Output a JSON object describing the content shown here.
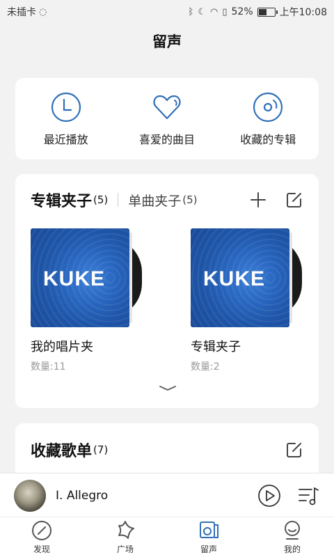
{
  "status_bar": {
    "carrier": "未插卡",
    "battery": "52%",
    "battery_level": 0.52,
    "time": "上午10:08"
  },
  "page_title": "留声",
  "quick_actions": [
    {
      "label": "最近播放",
      "icon": "clock-icon"
    },
    {
      "label": "喜爱的曲目",
      "icon": "heart-icon"
    },
    {
      "label": "收藏的专辑",
      "icon": "disc-icon"
    }
  ],
  "clip_section": {
    "tab_album": "专辑夹子",
    "tab_album_count": "(5)",
    "tab_single": "单曲夹子",
    "tab_single_count": "(5)",
    "albums": [
      {
        "cover_text": "KUKE",
        "name": "我的唱片夹",
        "count": "数量:11"
      },
      {
        "cover_text": "KUKE",
        "name": "专辑夹子",
        "count": "数量:2"
      }
    ]
  },
  "favorites": {
    "title": "收藏歌单",
    "count": "(7)"
  },
  "player": {
    "track": "I. Allegro"
  },
  "tabbar": [
    {
      "label": "发现",
      "icon": "compass-icon"
    },
    {
      "label": "广场",
      "icon": "square-icon"
    },
    {
      "label": "留声",
      "icon": "phonograph-icon"
    },
    {
      "label": "我的",
      "icon": "profile-icon"
    }
  ],
  "colors": {
    "accent": "#2f6fb8",
    "background": "#f2f2f2",
    "card": "#ffffff"
  }
}
